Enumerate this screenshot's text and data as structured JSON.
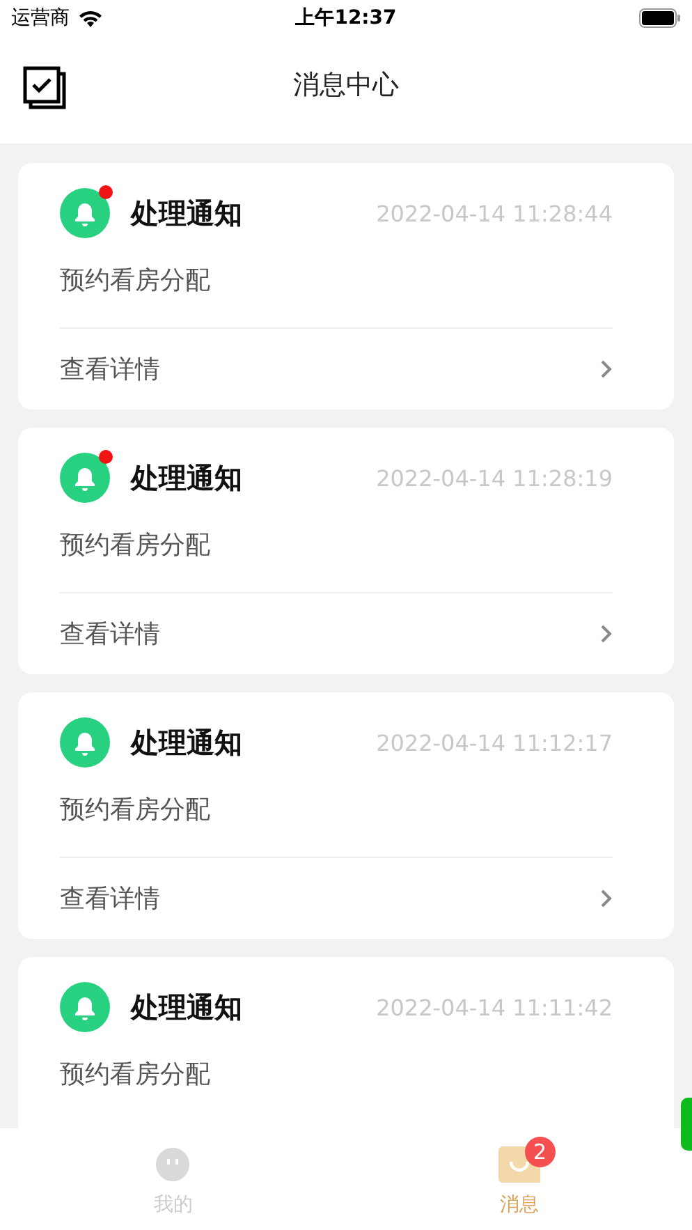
{
  "status_bar": {
    "carrier": "运营商",
    "time": "上午12:37"
  },
  "nav": {
    "title": "消息中心"
  },
  "messages": [
    {
      "title": "处理通知",
      "time": "2022-04-14 11:28:44",
      "body": "预约看房分配",
      "link": "查看详情",
      "unread": true
    },
    {
      "title": "处理通知",
      "time": "2022-04-14 11:28:19",
      "body": "预约看房分配",
      "link": "查看详情",
      "unread": true
    },
    {
      "title": "处理通知",
      "time": "2022-04-14 11:12:17",
      "body": "预约看房分配",
      "link": "查看详情",
      "unread": false
    },
    {
      "title": "处理通知",
      "time": "2022-04-14 11:11:42",
      "body": "预约看房分配",
      "unread": false
    }
  ],
  "tab_bar": [
    {
      "label": "我的",
      "selected": false
    },
    {
      "label": "消息",
      "selected": true,
      "badge": "2"
    }
  ]
}
